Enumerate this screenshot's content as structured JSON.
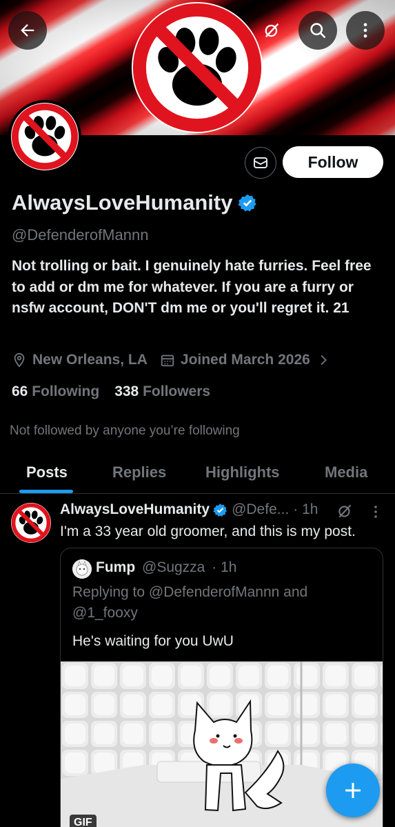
{
  "profile": {
    "display_name": "AlwaysLoveHumanity",
    "handle": "@DefenderofMannn",
    "bio": "Not trolling or bait. I genuinely hate furries. Feel free to add or dm me for whatever. If you are a furry or nsfw account, DON'T dm me or you'll regret it. 21",
    "location": "New Orleans, LA",
    "joined": "Joined March 2026",
    "following_count": "66",
    "following_label": "Following",
    "followers_count": "338",
    "followers_label": "Followers",
    "not_followed_note": "Not followed by anyone you’re following",
    "verified": true,
    "avatar_icon": "no-paw-icon",
    "banner_icon": "no-paw-icon"
  },
  "header": {
    "back_icon": "back-arrow-icon",
    "grok_icon": "grok-icon",
    "search_icon": "search-icon",
    "more_icon": "more-vertical-icon"
  },
  "actions": {
    "message_icon": "mail-icon",
    "follow_label": "Follow"
  },
  "tabs": [
    {
      "label": "Posts",
      "active": true
    },
    {
      "label": "Replies",
      "active": false
    },
    {
      "label": "Highlights",
      "active": false
    },
    {
      "label": "Media",
      "active": false
    }
  ],
  "post": {
    "author_name": "AlwaysLoveHumanity",
    "author_handle": "@Defe...",
    "time": "· 1h",
    "text": "I'm a 33 year old groomer, and this is my post.",
    "quote": {
      "author_name": "Fump",
      "author_handle": "@Sugzza",
      "time": "· 1h",
      "replying_to": "Replying to @DefenderofMannn and @1_fooxy",
      "text": "He's waiting for you UwU",
      "media_badge": "GIF"
    }
  },
  "fab": {
    "icon": "plus-icon"
  },
  "colors": {
    "accent": "#1d9bf0",
    "background": "#000000",
    "text_primary": "#e7e9ea",
    "text_secondary": "#71767b",
    "ban_red": "#e0141e"
  }
}
